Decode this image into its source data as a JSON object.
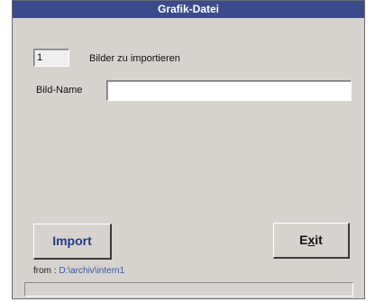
{
  "window": {
    "title": "Grafik-Datei"
  },
  "form": {
    "count_value": "1",
    "count_label": "Bilder zu importieren",
    "name_label": "Bild-Name",
    "name_value": ""
  },
  "buttons": {
    "import_label": "Import",
    "exit_label_prefix": "E",
    "exit_label_mnemonic": "x",
    "exit_label_suffix": "it"
  },
  "source": {
    "prefix": "from :",
    "path": "D:\\archiv\\intern1"
  },
  "status": {
    "text": ""
  },
  "colors": {
    "titlebar": "#3b4c8c",
    "window_bg": "#d6d3ce",
    "import_text": "#1f3c8c",
    "path_text": "#3a58a8"
  }
}
